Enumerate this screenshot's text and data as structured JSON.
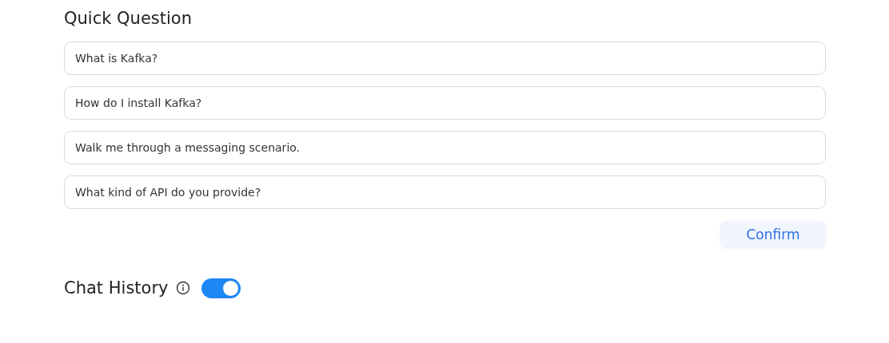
{
  "quick_question": {
    "title": "Quick Question",
    "questions": [
      {
        "value": "What is Kafka?"
      },
      {
        "value": "How do I install Kafka?"
      },
      {
        "value": "Walk me through a messaging scenario."
      },
      {
        "value": "What kind of API do you provide?"
      }
    ],
    "confirm_button": "Confirm"
  },
  "chat_history": {
    "title": "Chat History",
    "on": true
  }
}
